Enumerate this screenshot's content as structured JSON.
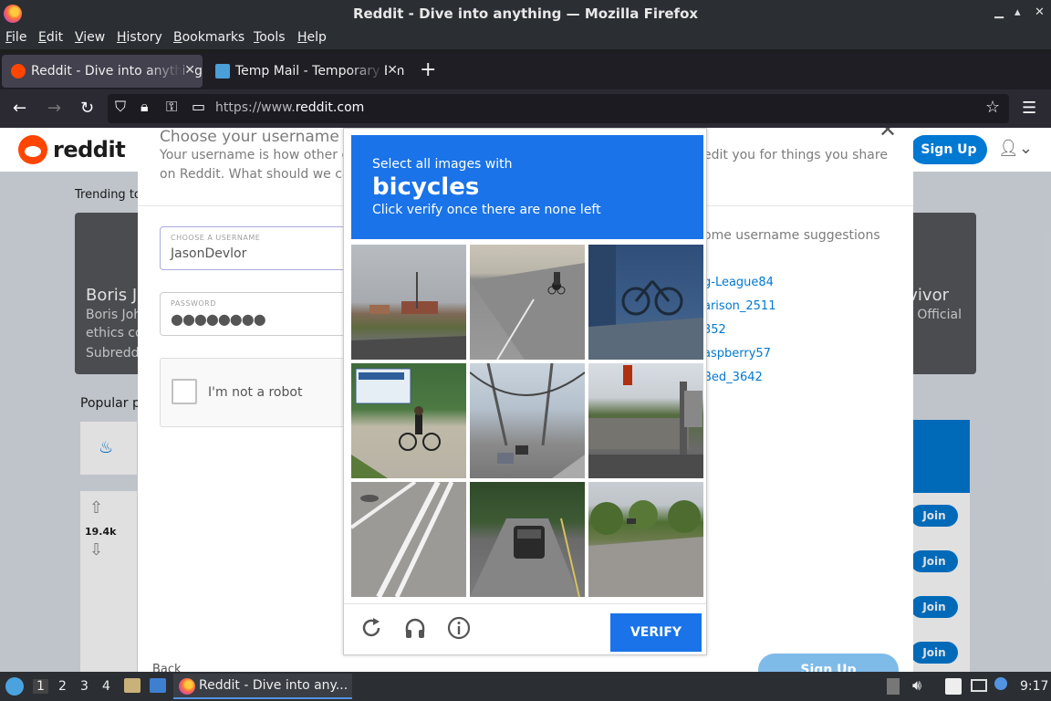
{
  "window": {
    "title": "Reddit - Dive into anything — Mozilla Firefox"
  },
  "menubar": [
    "File",
    "Edit",
    "View",
    "History",
    "Bookmarks",
    "Tools",
    "Help"
  ],
  "tabs": [
    {
      "label": "Reddit - Dive into anything",
      "active": true
    },
    {
      "label": "Temp Mail - Temporary Email",
      "active": false
    }
  ],
  "navbar": {
    "url_prefix": "https://www.",
    "url_host": "reddit.com"
  },
  "reddit": {
    "logo": "reddit",
    "signup": "Sign Up",
    "trending": "Trending to",
    "hero_left_title": "Boris J",
    "hero_left_sub1": "Boris Joh",
    "hero_left_sub2": "ethics co",
    "hero_left_sub3": "Subredd",
    "hero_right_title": "vivor",
    "hero_right_sub": "- Official",
    "popular": "Popular p",
    "vote_count": "19.4k",
    "join": "Join"
  },
  "modal": {
    "title": "Choose your username",
    "desc_line1": "Your username is how other co",
    "desc_line2": "on Reddit. What should we call",
    "desc_right": "edit you for things you share",
    "username_label": "CHOOSE A USERNAME",
    "username_value": "JasonDevlor",
    "password_label": "PASSWORD",
    "password_value": "●●●●●●●●",
    "robot_label": "I'm not a robot",
    "suggestions_title": "ome username suggestions",
    "suggestions": [
      "g-League84",
      "arison_2511",
      "352",
      "aspberry57",
      "Bed_3642"
    ],
    "back": "Back",
    "signup_button": "Sign Up"
  },
  "captcha": {
    "line1": "Select all images with",
    "target": "bicycles",
    "line3": "Click verify once there are none left",
    "verify": "VERIFY",
    "tiles": [
      "rural-road-houses",
      "cyclist-on-road",
      "parked-bicycle-wall",
      "cyclist-near-sign",
      "bridge-traffic",
      "street-building-traffic-light",
      "road-lane-markings",
      "car-on-road",
      "road-with-trees"
    ]
  },
  "taskbar": {
    "workspaces": [
      "1",
      "2",
      "3",
      "4"
    ],
    "task_label": "Reddit - Dive into any...",
    "clock": "9:17"
  }
}
